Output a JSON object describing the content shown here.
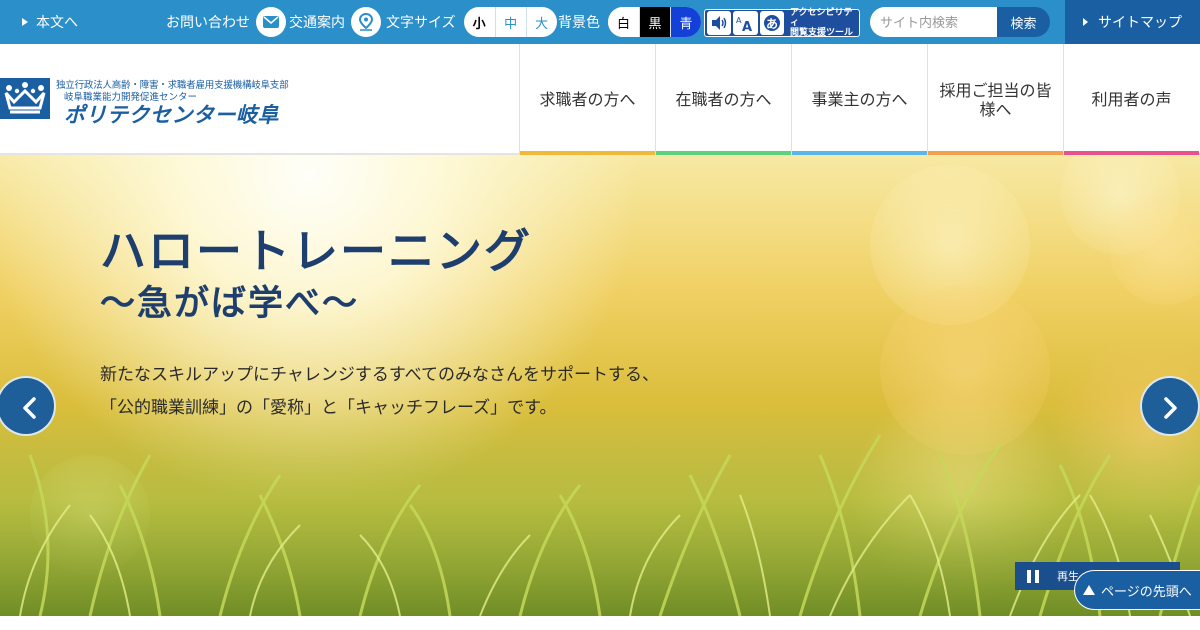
{
  "topbar": {
    "skip_link": "本文へ",
    "contact": "お問い合わせ",
    "access": "交通案内",
    "font_size_label": "文字サイズ",
    "font_sizes": [
      "小",
      "中",
      "大"
    ],
    "bg_color_label": "背景色",
    "bg_colors": [
      "白",
      "黒",
      "青"
    ],
    "a11y_tool_line1": "アクセシビリティ",
    "a11y_tool_line2": "閲覧支援ツール",
    "search_placeholder": "サイト内検索",
    "search_button": "検索",
    "sitemap": "サイトマップ"
  },
  "logo": {
    "sub1": "独立行政法人高齢・障害・求職者雇用支援機構岐阜支部",
    "sub2": "岐阜職業能力開発促進センター",
    "main": "ポリテクセンター岐阜"
  },
  "nav": [
    {
      "label": "求職者の方へ",
      "color": "#f0b93a"
    },
    {
      "label": "在職者の方へ",
      "color": "#5fd17c"
    },
    {
      "label": "事業主の方へ",
      "color": "#56b8ea"
    },
    {
      "label": "採用ご担当の皆様へ",
      "color": "#f0a04e"
    },
    {
      "label": "利用者の声",
      "color": "#e8528a"
    }
  ],
  "hero": {
    "title": "ハロートレーニング",
    "subtitle": "～急がば学べ～",
    "desc_line1": "新たなスキルアップにチャレンジするすべてのみなさんをサポートする、",
    "desc_line2": "「公的職業訓練」の「愛称」と「キャッチフレーズ」です。",
    "pause_label": "再生"
  },
  "page_top": "ページの先頭へ",
  "colors": {
    "topbar_bg": "#2b8fc9",
    "brand_dark": "#1b5fa3",
    "title_navy": "#1e3f6e"
  }
}
